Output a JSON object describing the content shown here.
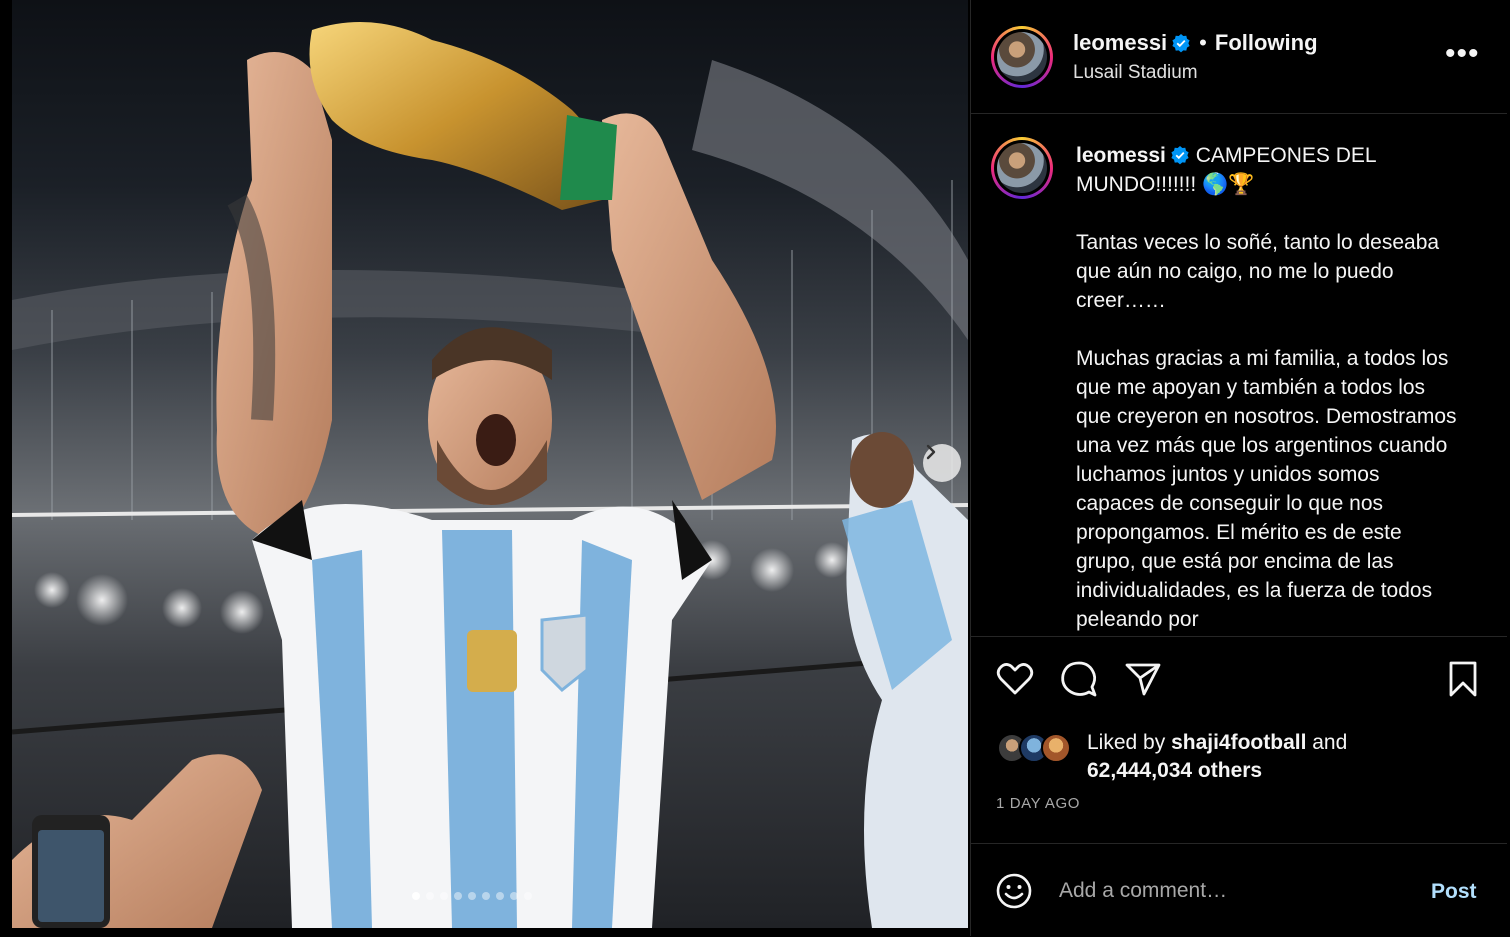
{
  "post": {
    "username": "leomessi",
    "follow_state": "Following",
    "bullet": "•",
    "location": "Lusail Stadium",
    "more_icon": "more-options-icon",
    "more_glyph": "•••"
  },
  "caption": {
    "username": "leomessi",
    "headline": "CAMPEONES DEL MUNDO!!!!!!! 🌎🏆",
    "paragraphs": [
      "Tantas veces lo soñé, tanto lo deseaba que aún no caigo, no me lo puedo creer……",
      "Muchas gracias a mi familia, a todos los que me apoyan y también a todos los que creyeron en nosotros. Demostramos una vez más que los argentinos cuando luchamos juntos y unidos somos capaces de conseguir lo que nos propongamos. El mérito es de este grupo, que está por encima de las individualidades, es la fuerza de todos peleando por"
    ]
  },
  "actions": {
    "like_icon": "heart-icon",
    "comment_icon": "comment-icon",
    "share_icon": "share-icon",
    "save_icon": "bookmark-icon"
  },
  "likes": {
    "prefix": "Liked by ",
    "top_liker": "shaji4football",
    "connector": " and",
    "count_text": "62,444,034 others"
  },
  "timestamp": "1 DAY AGO",
  "comment": {
    "placeholder": "Add a comment…",
    "post_label": "Post",
    "emoji_icon": "emoji-icon"
  },
  "carousel": {
    "slide_count": 9,
    "active_index": 0
  },
  "colors": {
    "background": "#000000",
    "verified": "#0095f6",
    "post_button": "#b2dffc",
    "secondary_text": "#a8a8a8"
  }
}
